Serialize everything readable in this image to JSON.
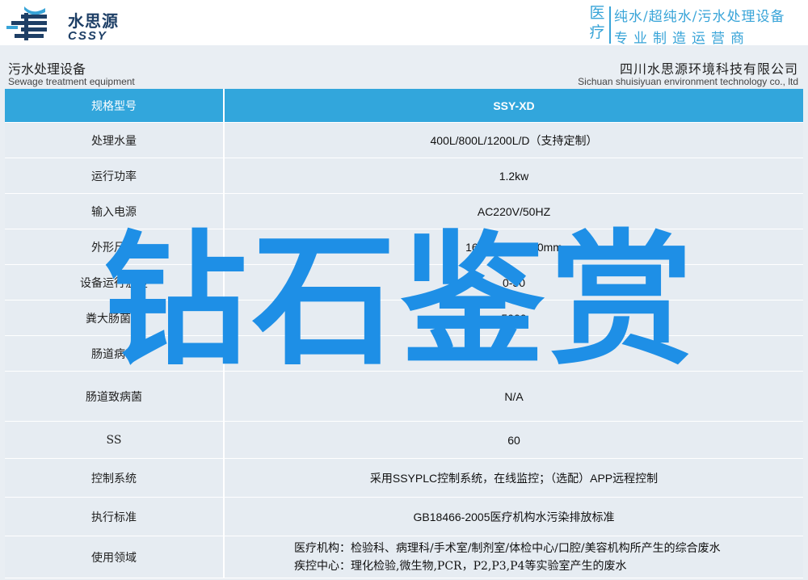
{
  "header": {
    "logo_cn": "水思源",
    "logo_en": "CSSY",
    "tag_left_1": "医",
    "tag_left_2": "疗",
    "tag_top": "纯水/超纯水/污水处理设备",
    "tag_bottom": "专业制造运营商"
  },
  "subheader": {
    "left_cn": "污水处理设备",
    "left_en": "Sewage treatment equipment",
    "right_cn": "四川水思源环境科技有限公司",
    "right_en": "Sichuan shuisiyuan environment technology co., ltd"
  },
  "table": {
    "header": {
      "label": "规格型号",
      "value": "SSY-XD"
    },
    "rows": [
      {
        "label": "处理水量",
        "value": "400L/800L/1200L/D（支持定制）"
      },
      {
        "label": "运行功率",
        "value": "1.2kw"
      },
      {
        "label": "输入电源",
        "value": "AC220V/50HZ"
      },
      {
        "label": "外形尺寸",
        "value": "1680*800*1440mm"
      },
      {
        "label": "设备运行温度",
        "value": "0-50"
      },
      {
        "label": "粪大肠菌群",
        "value": "5000"
      },
      {
        "label": "肠道病毒",
        "value": "N/A"
      },
      {
        "label": "肠道致病菌",
        "value": "N/A"
      },
      {
        "label": "SS",
        "value": "60"
      },
      {
        "label": "控制系统",
        "value": "采用SSYPLC控制系统，在线监控；（选配）APP远程控制"
      },
      {
        "label": "执行标准",
        "value": "GB18466-2005医疗机构水污染排放标准"
      }
    ],
    "usage": {
      "label": "使用领域",
      "line1": "医疗机构：检验科、病理科/手术室/制剂室/体检中心/口腔/美容机构所产生的综合废水",
      "line2": "疾控中心：理化检验,微生物,PCR，P2,P3,P4等实验室产生的废水"
    }
  },
  "watermark": "钻石鉴赏",
  "colors": {
    "accent": "#32a6dc",
    "brand_dark": "#1e3f66",
    "watermark": "#1e8fe6",
    "row_bg": "#e6ecf2"
  }
}
